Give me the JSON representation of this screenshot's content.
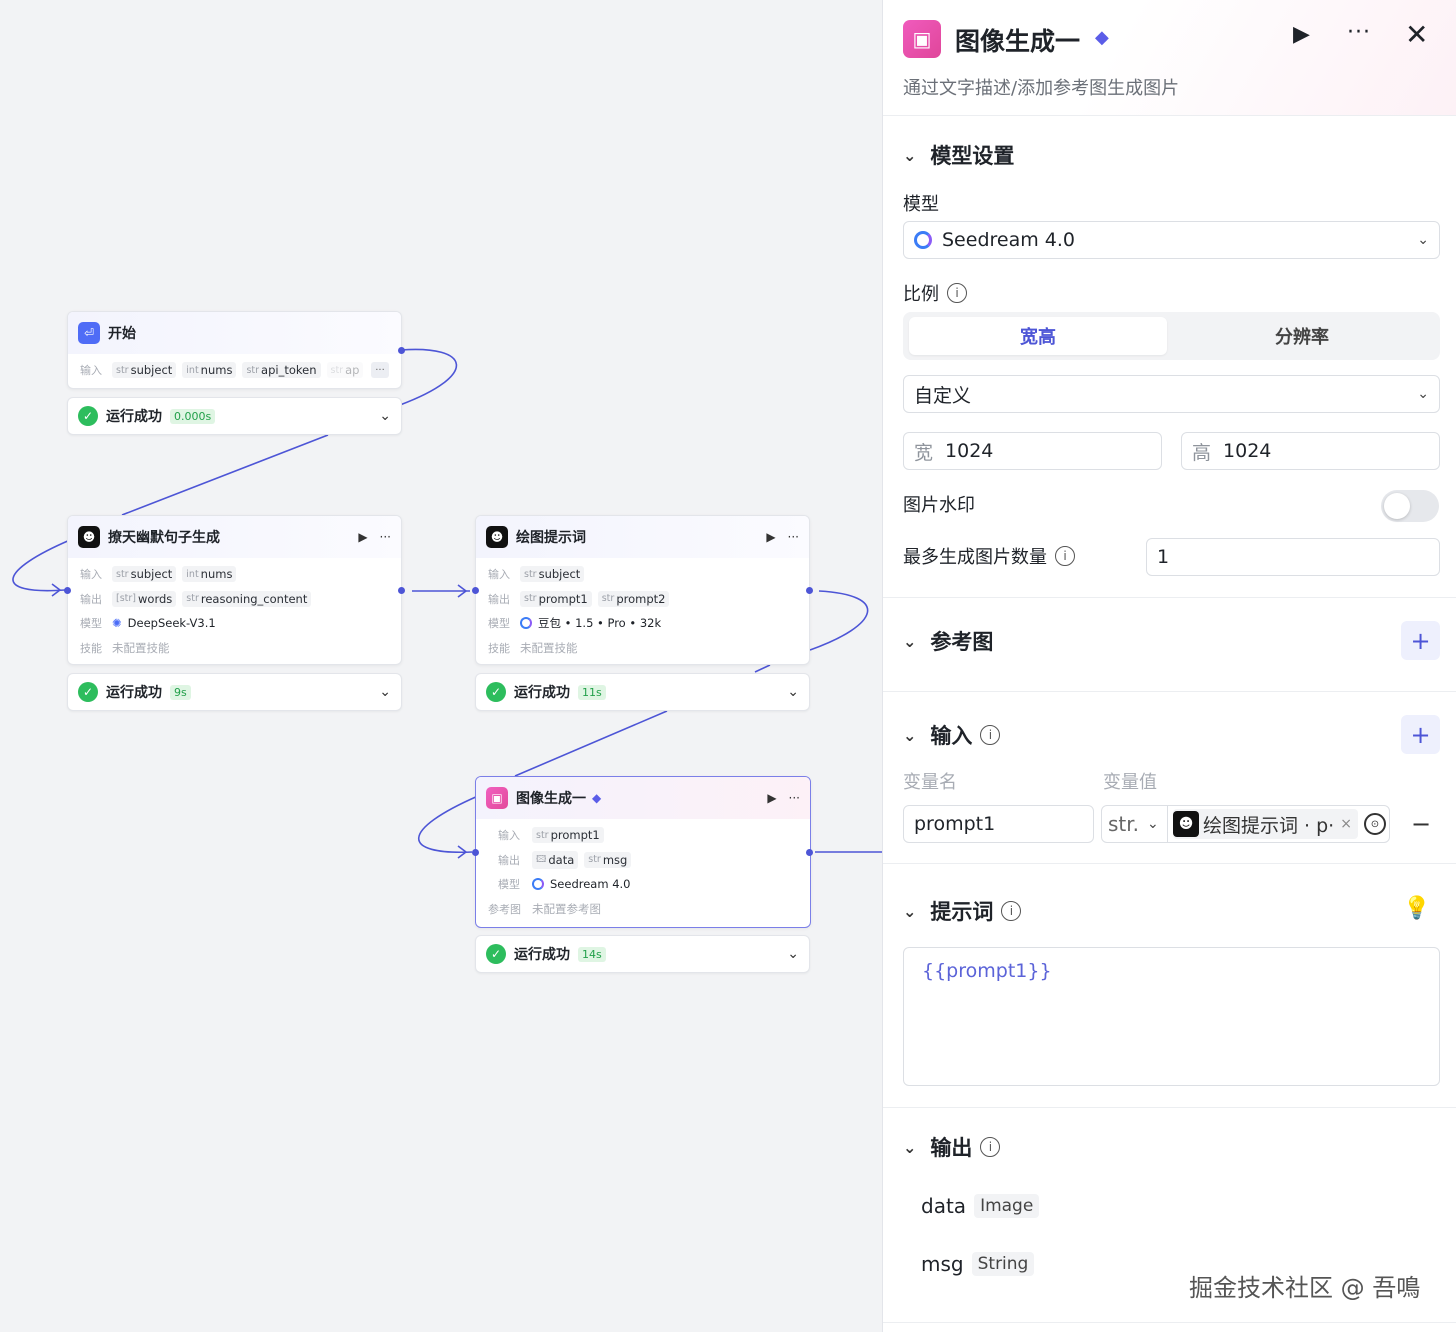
{
  "canvas": {
    "start_node": {
      "title": "开始",
      "input_label": "输入",
      "inputs": [
        {
          "type": "str",
          "name": "subject"
        },
        {
          "type": "int",
          "name": "nums"
        },
        {
          "type": "str",
          "name": "api_token"
        },
        {
          "type": "str",
          "name": "ap"
        }
      ],
      "more": "···",
      "status": "运行成功",
      "time": "0.000s"
    },
    "joke_node": {
      "title": "撩天幽默句子生成",
      "input_label": "输入",
      "output_label": "输出",
      "model_label": "模型",
      "skill_label": "技能",
      "inputs": [
        {
          "type": "str",
          "name": "subject"
        },
        {
          "type": "int",
          "name": "nums"
        }
      ],
      "outputs": [
        {
          "type": "[str]",
          "name": "words"
        },
        {
          "type": "str",
          "name": "reasoning_content"
        }
      ],
      "model": "DeepSeek-V3.1",
      "skill": "未配置技能",
      "status": "运行成功",
      "time": "9s"
    },
    "prompt_node": {
      "title": "绘图提示词",
      "input_label": "输入",
      "output_label": "输出",
      "model_label": "模型",
      "skill_label": "技能",
      "inputs": [
        {
          "type": "str",
          "name": "subject"
        }
      ],
      "outputs": [
        {
          "type": "str",
          "name": "prompt1"
        },
        {
          "type": "str",
          "name": "prompt2"
        }
      ],
      "model": "豆包 • 1.5 • Pro • 32k",
      "skill": "未配置技能",
      "status": "运行成功",
      "time": "11s"
    },
    "image_node": {
      "title": "图像生成一",
      "input_label": "输入",
      "output_label": "输出",
      "model_label": "模型",
      "ref_label": "参考图",
      "inputs": [
        {
          "type": "str",
          "name": "prompt1"
        }
      ],
      "outputs": [
        {
          "type": "img",
          "name": "data"
        },
        {
          "type": "str",
          "name": "msg"
        }
      ],
      "model": "Seedream 4.0",
      "ref": "未配置参考图",
      "status": "运行成功",
      "time": "14s"
    }
  },
  "panel": {
    "title": "图像生成一",
    "description": "通过文字描述/添加参考图生成图片",
    "model_section": {
      "heading": "模型设置",
      "model_label": "模型",
      "model_value": "Seedream 4.0",
      "ratio_label": "比例",
      "ratio_tabs": [
        "宽高",
        "分辨率"
      ],
      "ratio_select": "自定义",
      "width_label": "宽",
      "width_value": "1024",
      "height_label": "高",
      "height_value": "1024",
      "watermark_label": "图片水印",
      "watermark_on": false,
      "max_count_label": "最多生成图片数量",
      "max_count_value": "1"
    },
    "ref_section": {
      "heading": "参考图"
    },
    "input_section": {
      "heading": "输入",
      "col_name": "变量名",
      "col_value": "变量值",
      "var_name": "prompt1",
      "var_type": "str.",
      "var_ref": "绘图提示词 · p·"
    },
    "prompt_section": {
      "heading": "提示词",
      "content": "{{prompt1}}"
    },
    "output_section": {
      "heading": "输出",
      "outputs": [
        {
          "name": "data",
          "type": "Image"
        },
        {
          "name": "msg",
          "type": "String"
        }
      ]
    }
  },
  "watermark": "掘金技术社区 @ 吾鳴",
  "colors": {
    "accent": "#4d55d6",
    "success": "#2dbd5d",
    "image_node": "#e34a9a"
  }
}
